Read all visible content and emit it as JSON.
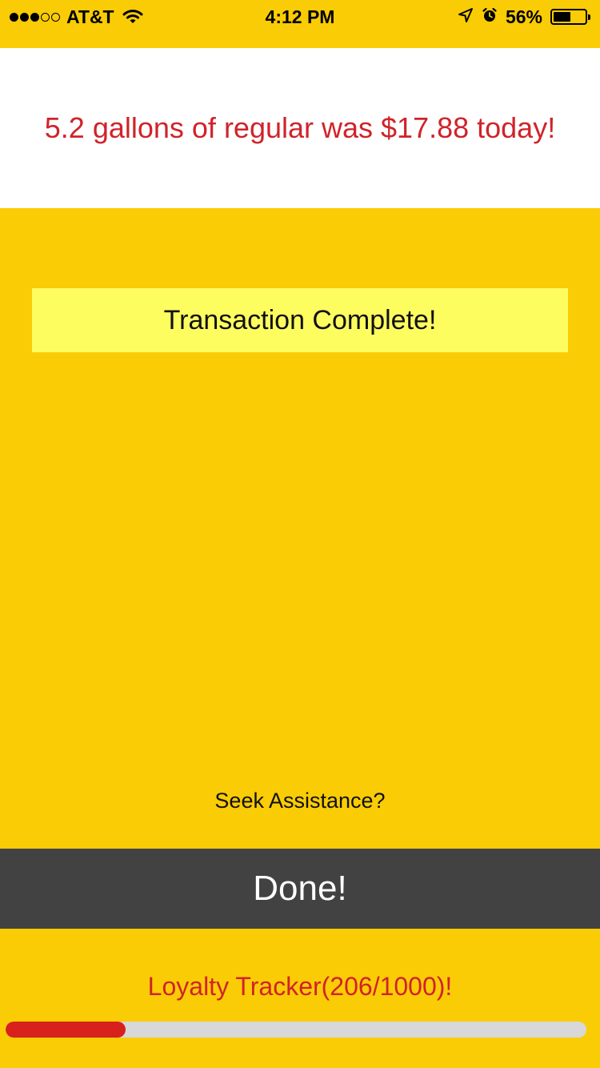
{
  "status_bar": {
    "signal_bars_filled": 3,
    "signal_bars_total": 5,
    "carrier": "AT&T",
    "time": "4:12 PM",
    "battery_percent": "56%",
    "battery_level": 0.56,
    "icons": [
      "wifi-icon",
      "location-arrow-icon",
      "alarm-clock-icon",
      "battery-icon"
    ]
  },
  "banner": {
    "message": "5.2 gallons of regular was $17.88 today!"
  },
  "transaction": {
    "status_text": "Transaction Complete!"
  },
  "assist": {
    "link_text": "Seek Assistance?"
  },
  "done_button": {
    "label": "Done!"
  },
  "loyalty": {
    "label": "Loyalty Tracker(206/1000)!",
    "current": 206,
    "max": 1000
  },
  "colors": {
    "background": "#FACC05",
    "banner_background": "#FFFFFF",
    "accent_red": "#D0232A",
    "status_box": "#FEFD60",
    "done_button": "#424242",
    "progress_track": "#D8D8D8",
    "progress_fill": "#D8201C"
  }
}
